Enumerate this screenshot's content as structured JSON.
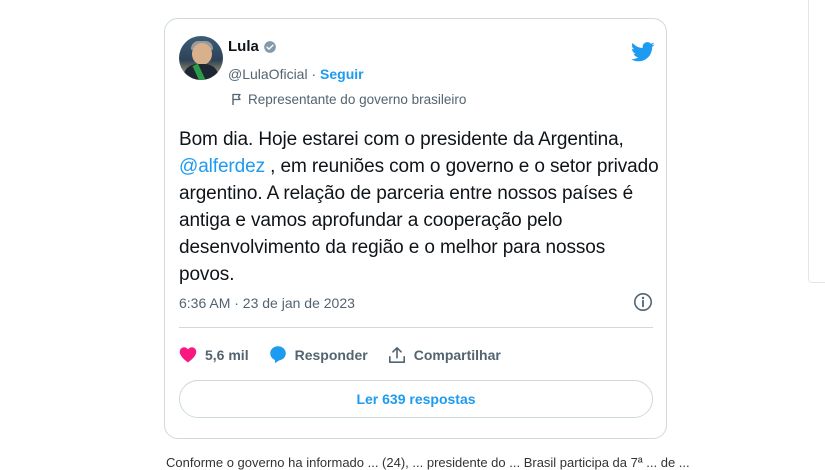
{
  "tweet": {
    "author_name": "Lula",
    "handle": "@LulaOficial",
    "separator": " · ",
    "follow_label": "Seguir",
    "gov_label": "Representante do governo brasileiro",
    "text_part1": "Bom dia. Hoje estarei com o presidente da Argentina, ",
    "mention": "@alferdez",
    "text_part2": " , em reuniões com o governo e o setor privado argentino. A relação de parceria entre nossos países é antiga e vamos aprofundar a cooperação pelo desenvolvimento da região e o melhor para nossos povos.",
    "timestamp": "6:36 AM · 23 de jan de 2023",
    "likes": "5,6 mil",
    "reply_label": "Responder",
    "share_label": "Compartilhar",
    "read_replies_label": "Ler 639 respostas"
  },
  "page": {
    "below_text": "Conforme o governo ha informado ... (24), ... presidente do ... Brasil participa da 7ª ... de ..."
  },
  "colors": {
    "twitter_blue": "#1d9bf0",
    "like_red": "#f91880",
    "muted": "#536471"
  }
}
